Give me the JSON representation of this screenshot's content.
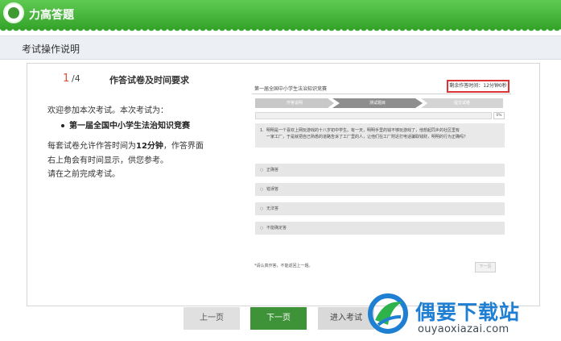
{
  "header": {
    "app_title": "力高答题"
  },
  "section": {
    "title": "考试操作说明"
  },
  "intro": {
    "step_current": "1",
    "step_total": "/4",
    "title": "作答试卷及时间要求",
    "welcome": "欢迎参加本次考试。本次考试为：",
    "exam_name": "第一届全国中小学生法治知识竞赛",
    "time_line1_a": "每套试卷允许作答时间为",
    "time_line1_b": "12分钟",
    "time_line1_c": "，作答界面",
    "time_line2": "右上角会有时间显示，供您参考。",
    "time_line3": "请在之前完成考试。"
  },
  "preview": {
    "exam_title": "第一届全国中小学生法治知识竞赛",
    "timer": "剩余作答时间：12分钟0秒",
    "steps": [
      "作答说明",
      "测试题目",
      "提交试卷"
    ],
    "progress_pct": "0%",
    "question_number": "1.",
    "question_line1": "明明是一个喜欢上网玩游戏的十八岁初中学生。有一天，明明手里的钱不够玩游戏了，他想起同乡的社区里有",
    "question_line2": "一家工厂，于是就把自己熟悉的道路告诉了工厂里的人，让他们在工厂附近打电话骗取钱财，明明的行为正确吗？",
    "options": [
      {
        "mark": "○",
        "label": "正确答"
      },
      {
        "mark": "○",
        "label": "错误答"
      },
      {
        "mark": "○",
        "label": "无法答"
      },
      {
        "mark": "○",
        "label": "不能确定答"
      }
    ],
    "note": "*请认真作答，不能返回上一题。",
    "next_label": "下一页"
  },
  "buttons": {
    "prev": "上一页",
    "next": "下一页",
    "enter": "进入考试"
  },
  "watermark": {
    "brand": "偶要下载站",
    "url": "ouyaoxiazai.com"
  }
}
